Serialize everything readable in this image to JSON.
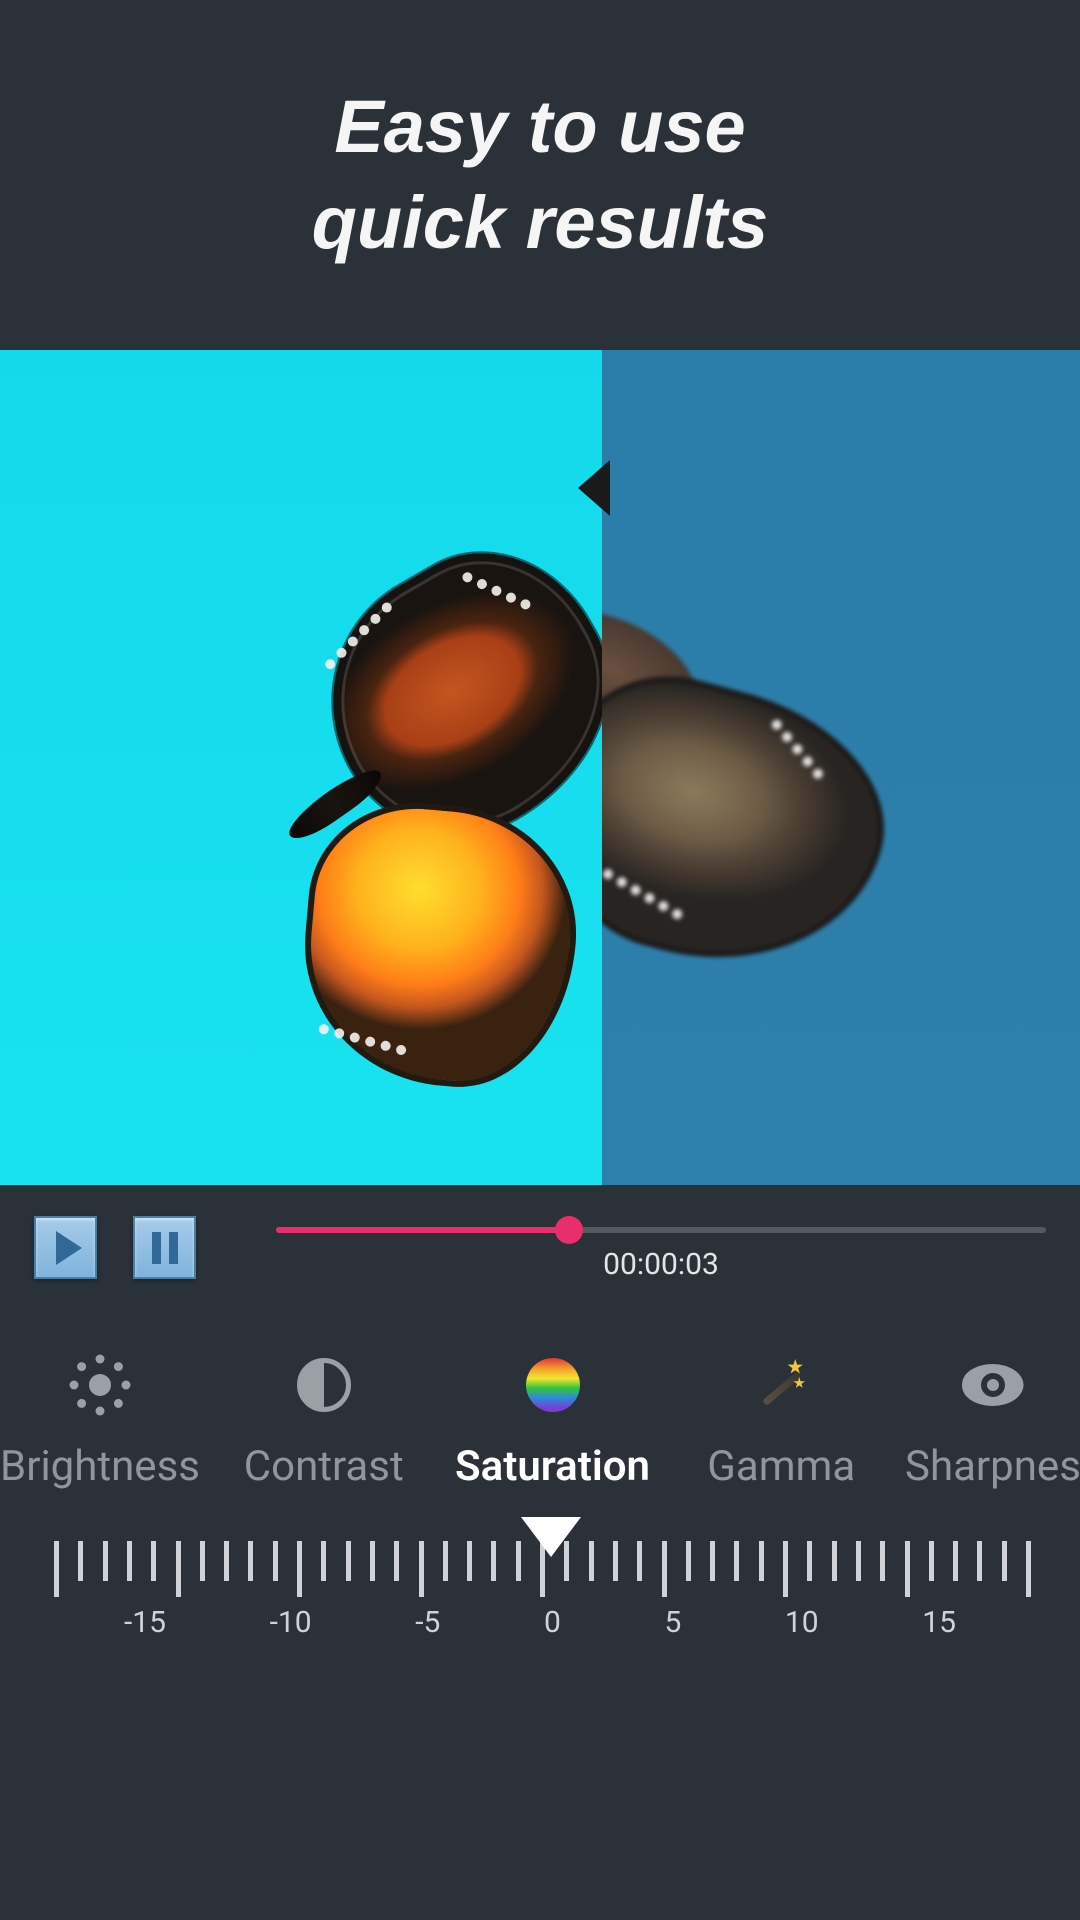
{
  "header": {
    "line1": "Easy to use",
    "line2": "quick results"
  },
  "preview": {
    "split_position_pct": 55
  },
  "playback": {
    "timecode": "00:00:03",
    "progress_pct": 38
  },
  "adjustments": [
    {
      "key": "brightness",
      "label": "Brightness",
      "active": false
    },
    {
      "key": "contrast",
      "label": "Contrast",
      "active": false
    },
    {
      "key": "saturation",
      "label": "Saturation",
      "active": true
    },
    {
      "key": "gamma",
      "label": "Gamma",
      "active": false
    },
    {
      "key": "sharpness",
      "label": "Sharpness",
      "active": false
    }
  ],
  "ruler": {
    "min": -20,
    "max": 20,
    "value": 0,
    "labels": [
      "-15",
      "-10",
      "-5",
      "0",
      "5",
      "10",
      "15"
    ]
  }
}
